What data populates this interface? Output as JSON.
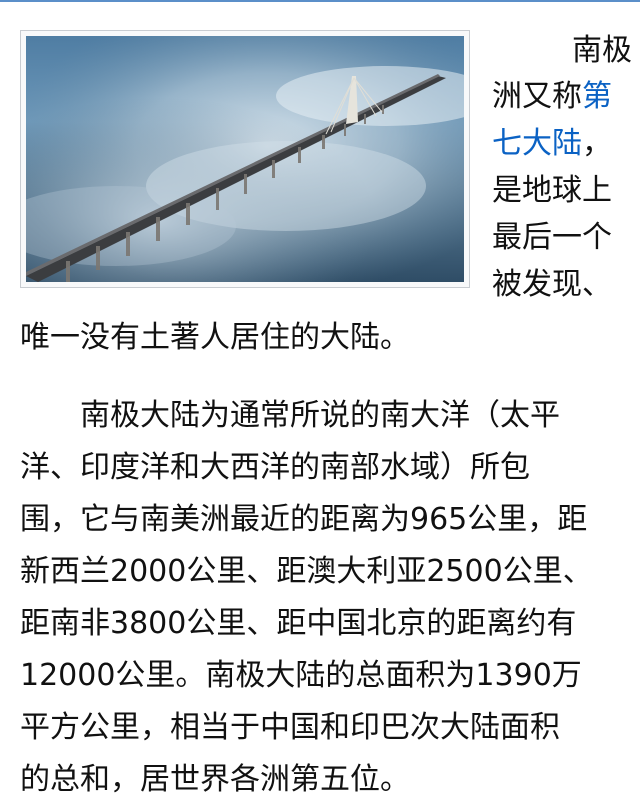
{
  "article": {
    "image_alt": "Bridge over clouds",
    "para1": {
      "line1": "南极",
      "line2_text": "洲又称",
      "line2_link": "第",
      "line3_link": "七大陆",
      "line3_text": "，",
      "line4": "是地球上",
      "line5": "最后一个",
      "line6": "被发现、",
      "line7": "唯一没有土著人居住的大陆。"
    },
    "para2": {
      "lines": [
        "　　南极大陆为通常所说的南大洋（太平",
        "洋、印度洋和大西洋的南部水域）所包",
        "围，它与南美洲最近的距离为965公里，距",
        "新西兰2000公里、距澳大利亚2500公里、",
        "距南非3800公里、距中国北京的距离约有",
        "12000公里。南极大陆的总面积为1390万",
        "平方公里，相当于中国和印巴次大陆面积",
        "的总和，居世界各洲第五位。"
      ]
    }
  },
  "colors": {
    "link": "#0b62c4",
    "accent_rule": "#5b8fc9"
  }
}
